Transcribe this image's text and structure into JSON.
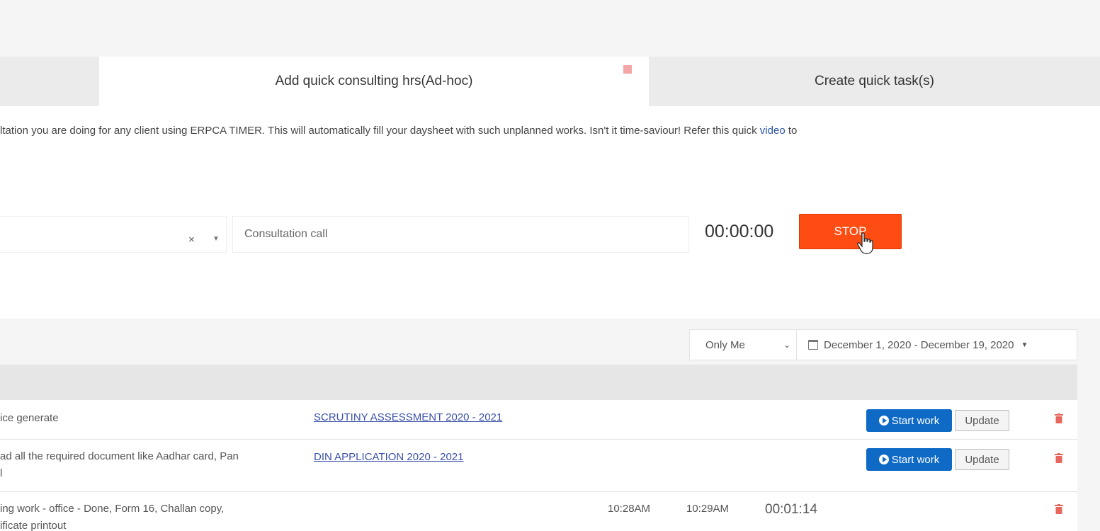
{
  "tabs": {
    "consulting": "Add quick consulting hrs(Ad-hoc)",
    "quick_task": "Create quick task(s)"
  },
  "info": {
    "text": "ltation you are doing for any client using ERPCA TIMER. This will automatically fill your daysheet with such unplanned works. Isn't it time-saviour! Refer this quick ",
    "link": "video",
    "tail": " to"
  },
  "timer_form": {
    "clear": "×",
    "task_value": "Consultation call",
    "elapsed": "00:00:00",
    "stop_label": "STOP"
  },
  "filters": {
    "user": "Only Me",
    "date_range": "December 1, 2020 - December 19, 2020"
  },
  "rows": [
    {
      "desc1": "ice generate",
      "desc2": "",
      "project": "SCRUTINY ASSESSMENT 2020 - 2021",
      "start_label": "Start work",
      "update_label": "Update"
    },
    {
      "desc1": "ad all the required document like Aadhar card, Pan",
      "desc2": "l",
      "project": "DIN APPLICATION 2020 - 2021",
      "start_label": "Start work",
      "update_label": "Update"
    },
    {
      "desc1": "ing work - office - Done, Form 16, Challan copy,",
      "desc2": "ificate printout",
      "start_time": "10:28AM",
      "end_time": "10:29AM",
      "duration": "00:01:14"
    }
  ],
  "colors": {
    "stop": "#ff4c12",
    "start": "#0f6ac6",
    "link": "#3c52a8",
    "delete": "#e8675c"
  }
}
